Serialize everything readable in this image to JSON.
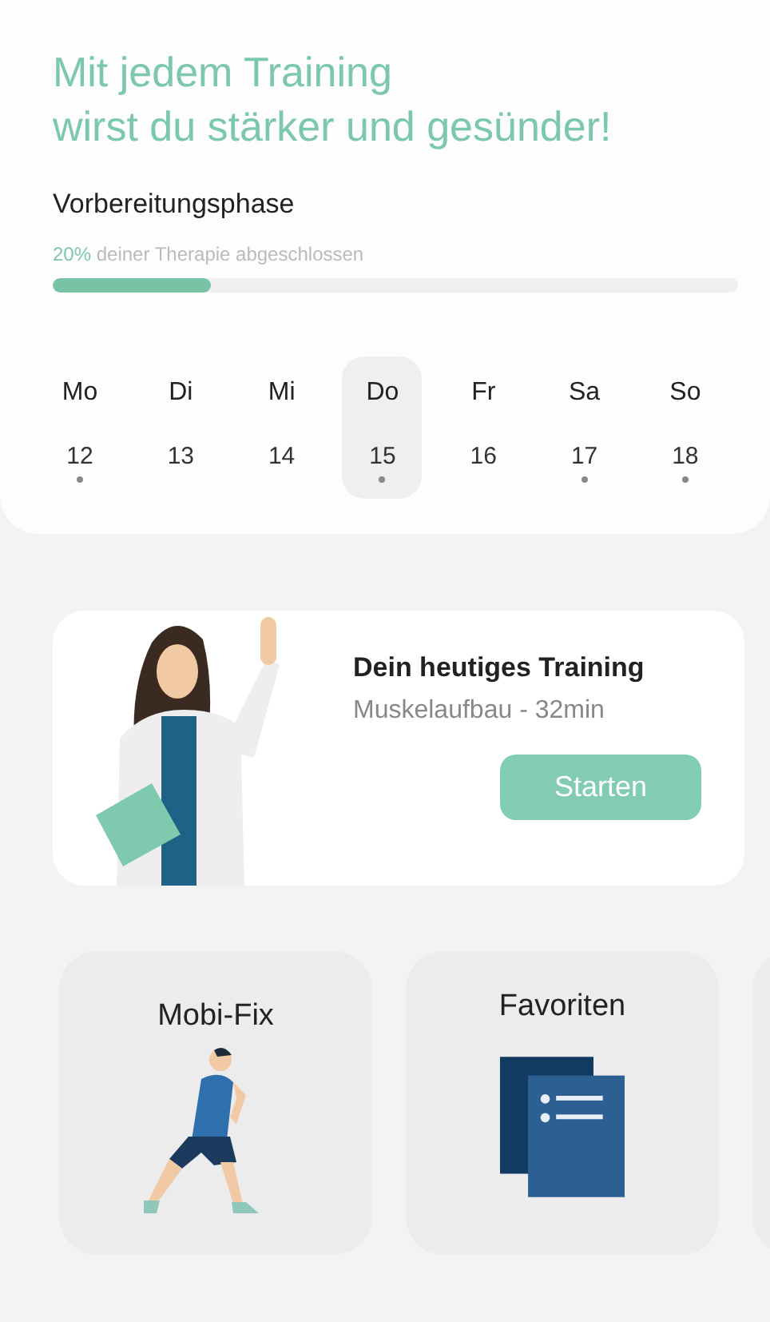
{
  "headline": [
    "Mit jedem Training",
    "wirst du stärker und gesünder!"
  ],
  "phase": {
    "title": "Vorbereitungsphase",
    "percent": "20%",
    "progress_text": "deiner Therapie abgeschlossen",
    "level": 0.23
  },
  "week": [
    {
      "day": "Mo",
      "date": "12",
      "selected": false,
      "dot": true
    },
    {
      "day": "Di",
      "date": "13",
      "selected": false,
      "dot": false
    },
    {
      "day": "Mi",
      "date": "14",
      "selected": false,
      "dot": false
    },
    {
      "day": "Do",
      "date": "15",
      "selected": true,
      "dot": true
    },
    {
      "day": "Fr",
      "date": "16",
      "selected": false,
      "dot": false
    },
    {
      "day": "Sa",
      "date": "17",
      "selected": false,
      "dot": true
    },
    {
      "day": "So",
      "date": "18",
      "selected": false,
      "dot": true
    }
  ],
  "training": {
    "title": "Dein heutiges Training",
    "subtitle": "Muskelaufbau - 32min",
    "button": "Starten"
  },
  "tiles": [
    {
      "kind": "runner",
      "title": "Mobi-Fix"
    },
    {
      "kind": "documents",
      "title": "Favoriten"
    },
    {
      "kind": "empty"
    }
  ]
}
